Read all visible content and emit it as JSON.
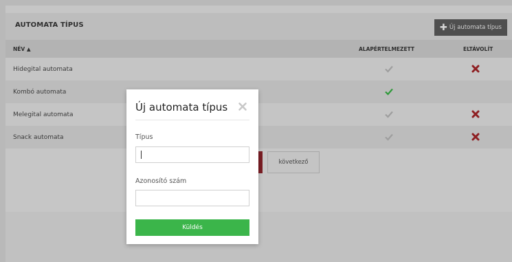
{
  "header": {
    "title": "AUTOMATA TÍPUS",
    "new_button_label": "Új automata típus",
    "new_button_icon": "plus-icon"
  },
  "table": {
    "columns": [
      "NÉV ▲",
      "ALAPÉRTELMEZETT",
      "ELTÁVOLÍT"
    ],
    "rows": [
      {
        "name": "Hidegital automata",
        "default": false,
        "removable": true
      },
      {
        "name": "Kombó automata",
        "default": true,
        "removable": false
      },
      {
        "name": "Melegital automata",
        "default": false,
        "removable": true
      },
      {
        "name": "Snack automata",
        "default": false,
        "removable": true
      }
    ]
  },
  "pager": {
    "next_label": "következő"
  },
  "modal": {
    "title": "Új automata típus",
    "close_icon": "close-icon",
    "type_label": "Típus",
    "type_value": "",
    "id_label": "Azonosító szám",
    "id_value": "",
    "submit_label": "Küldés"
  },
  "colors": {
    "accent_green": "#3bb54a",
    "remove_red": "#b21f24",
    "check_gray": "#9e9e9e",
    "check_green": "#2f9a3a"
  }
}
